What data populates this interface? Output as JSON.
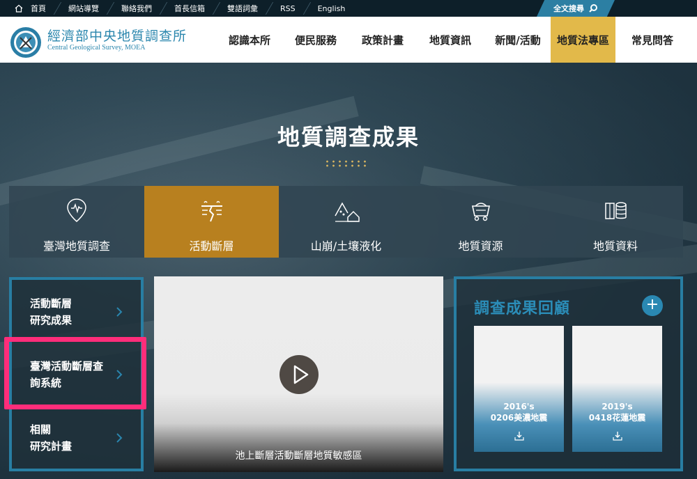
{
  "topbar": {
    "links": [
      "首頁",
      "網站導覽",
      "聯絡我們",
      "首長信箱",
      "雙語詞彙",
      "RSS",
      "English"
    ],
    "search_label": "全文搜尋"
  },
  "header": {
    "brand_zh": "經濟部中央地質調查所",
    "brand_en": "Central Geological Survey, MOEA",
    "nav": [
      "認識本所",
      "便民服務",
      "政策計畫",
      "地質資訊",
      "新聞/活動",
      "地質法專區",
      "常見問答"
    ],
    "active_nav": "地質法專區"
  },
  "hero": {
    "title": "地質調查成果"
  },
  "categories": {
    "items": [
      "臺灣地質調查",
      "活動斷層",
      "山崩/土壤液化",
      "地質資源",
      "地質資料"
    ],
    "active": "活動斷層"
  },
  "left_menu": {
    "items": [
      {
        "line1": "活動斷層",
        "line2": "研究成果"
      },
      {
        "line1": "臺灣活動斷層查",
        "line2": "詢系統"
      },
      {
        "line1": "相關",
        "line2": "研究計畫"
      }
    ]
  },
  "video": {
    "caption": "池上斷層活動斷層地質敏感區"
  },
  "review": {
    "title": "調查成果回顧",
    "cards": [
      {
        "line1": "2016's",
        "line2": "0206美濃地震"
      },
      {
        "line1": "2019's",
        "line2": "0418花蓮地震"
      }
    ]
  },
  "colors": {
    "accent_blue": "#287ea3",
    "nav_active": "#e2b94a",
    "tab_active": "#b8801f",
    "highlight": "#ff2d7a"
  }
}
